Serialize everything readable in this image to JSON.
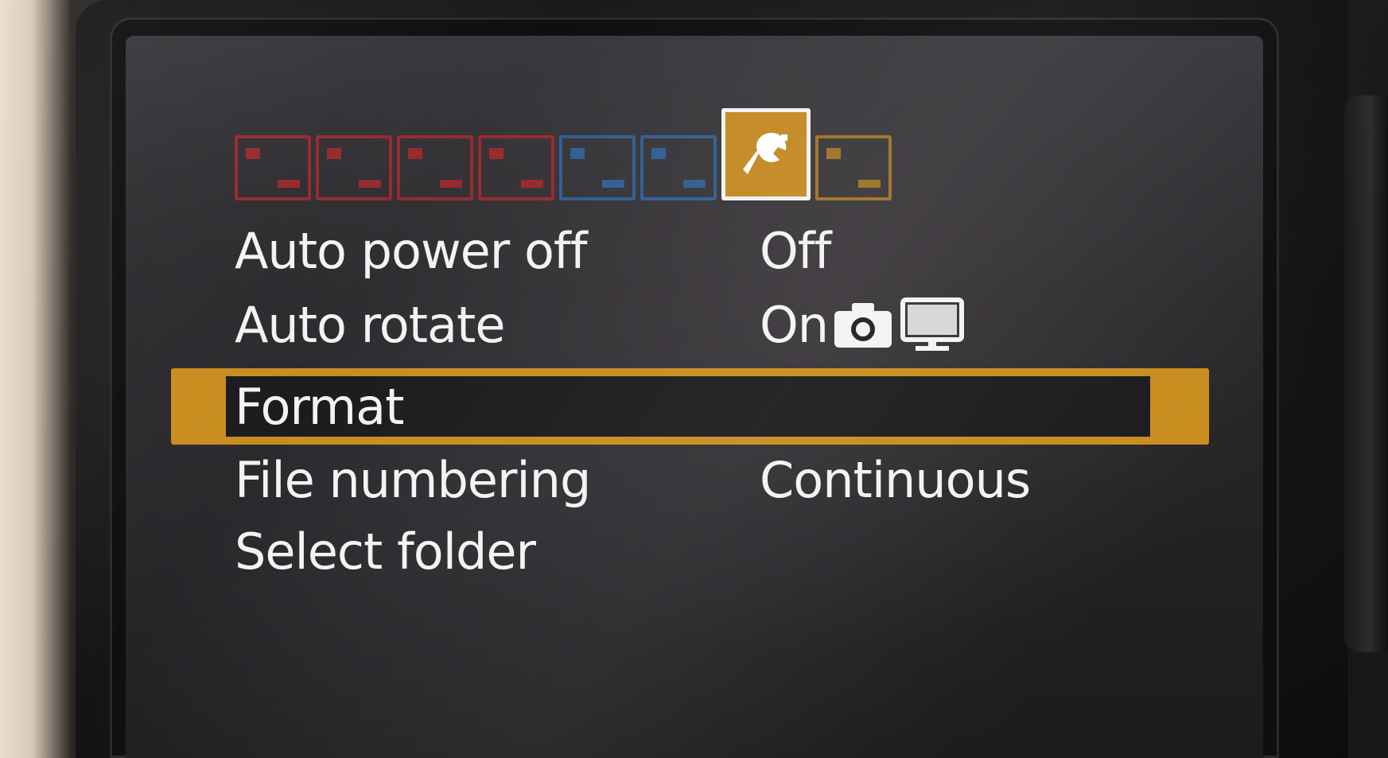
{
  "menu": {
    "tabs": [
      {
        "name": "shooting-tab-1",
        "color": "#c0282c"
      },
      {
        "name": "shooting-tab-2",
        "color": "#c0282c"
      },
      {
        "name": "shooting-tab-3",
        "color": "#c0282c"
      },
      {
        "name": "shooting-tab-4",
        "color": "#c0282c"
      },
      {
        "name": "playback-tab-1",
        "color": "#2f6fb8"
      },
      {
        "name": "playback-tab-2",
        "color": "#2f6fb8"
      },
      {
        "name": "setup-tab-1",
        "color": "#c98d1f",
        "active": true,
        "icon": "wrench-icon"
      },
      {
        "name": "setup-tab-2",
        "color": "#c98d1f"
      }
    ],
    "items": [
      {
        "label": "Auto power off",
        "value": "Off"
      },
      {
        "label": "Auto rotate",
        "value": "On",
        "value_icons": [
          "camera-icon",
          "monitor-icon"
        ]
      },
      {
        "label": "Format",
        "value": "",
        "selected": true
      },
      {
        "label": "File numbering",
        "value": "Continuous"
      },
      {
        "label": "Select folder",
        "value": ""
      }
    ]
  },
  "colors": {
    "highlight": "#c98d1f",
    "text": "#f3f3f3",
    "screen_bg": "#1c1b1e"
  }
}
